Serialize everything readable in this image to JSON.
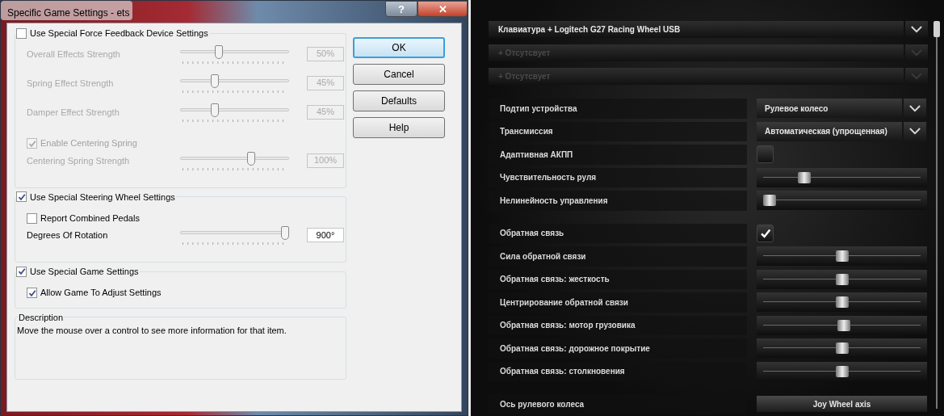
{
  "dialog": {
    "title": "Specific Game Settings - ets",
    "title_buttons": [
      "?",
      "✕"
    ],
    "groups": [
      {
        "header": {
          "label": "Use Special Force Feedback Device Settings",
          "checked": false
        },
        "items": [
          {
            "kind": "slider",
            "label": "Overall Effects Strength",
            "level": 0.34,
            "reading": "50%",
            "disabled": true
          },
          {
            "kind": "slider",
            "label": "Spring Effect Strength",
            "level": 0.3,
            "reading": "45%",
            "disabled": true
          },
          {
            "kind": "slider",
            "label": "Damper Effect Strength",
            "level": 0.3,
            "reading": "45%",
            "disabled": true
          },
          {
            "kind": "checkbox",
            "label": "Enable Centering Spring",
            "checked": true,
            "disabled": true
          },
          {
            "kind": "slider",
            "label": "Centering Spring Strength",
            "level": 0.66,
            "reading": "100%",
            "disabled": true
          }
        ]
      },
      {
        "header": {
          "label": "Use Special Steering Wheel Settings",
          "checked": true
        },
        "items": [
          {
            "kind": "checkbox",
            "label": "Report Combined Pedals",
            "checked": false,
            "disabled": false
          },
          {
            "kind": "slider",
            "label": "Degrees Of Rotation",
            "level": 1,
            "reading": "900°",
            "disabled": false
          }
        ]
      },
      {
        "header": {
          "label": "Use Special Game Settings",
          "checked": true
        },
        "items": [
          {
            "kind": "checkbox",
            "label": "Allow Game To Adjust Settings",
            "checked": true,
            "disabled": false
          }
        ]
      }
    ],
    "description": {
      "title": "Description",
      "text": "Move the mouse over a control to see more information for that item."
    },
    "buttons": [
      {
        "label": "OK",
        "default": true
      },
      {
        "label": "Cancel",
        "default": false
      },
      {
        "label": "Defaults",
        "default": false
      },
      {
        "label": "Help",
        "default": false
      }
    ]
  },
  "game": {
    "devices": [
      {
        "label": "Клавиатура + Logitech G27 Racing Wheel USB",
        "disabled": false
      },
      {
        "label": "+ Отсутсвует",
        "disabled": true
      },
      {
        "label": "+ Отсутсвует",
        "disabled": true
      }
    ],
    "sections": [
      [
        {
          "kind": "dropdown",
          "label": "Подтип устройства",
          "value": "Рулевое колесо"
        },
        {
          "kind": "dropdown",
          "label": "Трансмиссия",
          "value": "Автоматическая (упрощенная)"
        },
        {
          "kind": "checkbox",
          "label": "Адаптивная АКПП",
          "checked": false
        },
        {
          "kind": "slider",
          "label": "Чувствительность руля",
          "level": 0.25
        },
        {
          "kind": "slider",
          "label": "Нелинейность управления",
          "level": 0.02
        }
      ],
      [
        {
          "kind": "checkbox",
          "label": "Обратная связь",
          "checked": true
        },
        {
          "kind": "slider",
          "label": "Сила обратной связи",
          "level": 0.5
        },
        {
          "kind": "slider",
          "label": "Обратная связь: жесткость",
          "level": 0.5
        },
        {
          "kind": "slider",
          "label": "Центрирование обратной связи",
          "level": 0.5
        },
        {
          "kind": "slider",
          "label": "Обратная связь: мотор грузовика",
          "level": 0.51
        },
        {
          "kind": "slider",
          "label": "Обратная связь: дорожное покрытие",
          "level": 0.5
        },
        {
          "kind": "slider",
          "label": "Обратная связь: столкновения",
          "level": 0.5
        }
      ],
      [
        {
          "kind": "button",
          "label": "Ось рулевого колеса",
          "value": "Joy Wheel axis"
        }
      ]
    ]
  }
}
